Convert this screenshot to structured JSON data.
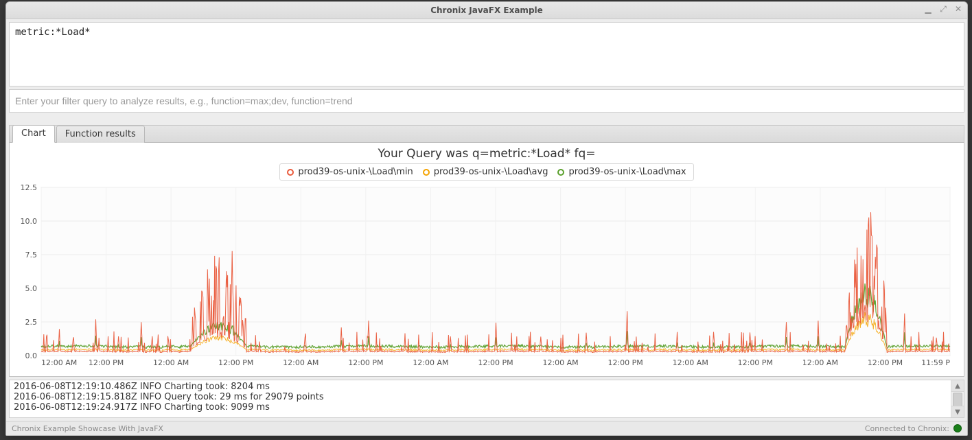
{
  "window": {
    "title": "Chronix JavaFX Example"
  },
  "query": {
    "value": "metric:*Load*"
  },
  "filter": {
    "placeholder": "Enter your filter query to analyze results, e.g., function=max;dev, function=trend",
    "value": ""
  },
  "tabs": [
    {
      "label": "Chart",
      "active": true
    },
    {
      "label": "Function results",
      "active": false
    }
  ],
  "chart_data": {
    "type": "line",
    "title": "Your Query was q=metric:*Load* fq=",
    "xlabel": "",
    "ylabel": "",
    "ylim": [
      0,
      12.5
    ],
    "yticks": [
      0.0,
      2.5,
      5.0,
      7.5,
      10.0,
      12.5
    ],
    "xticks": [
      "12:00 AM",
      "12:00 PM",
      "12:00 AM",
      "12:00 PM",
      "12:00 AM",
      "12:00 PM",
      "12:00 AM",
      "12:00 PM",
      "12:00 AM",
      "12:00 PM",
      "12:00 AM",
      "12:00 PM",
      "12:00 AM",
      "12:00 PM",
      "11:59 P"
    ],
    "legend_position": "top",
    "series": [
      {
        "name": "prod39-os-unix-\\Load\\min",
        "color": "#e9593a"
      },
      {
        "name": "prod39-os-unix-\\Load\\avg",
        "color": "#f4a300"
      },
      {
        "name": "prod39-os-unix-\\Load\\max",
        "color": "#5aa02c"
      }
    ],
    "baseline_note": "min/avg/max overlap near ~0.3–0.8 across most of the range; spikes are driven by the 'min' (orange-red) series; the green max band swells in burst regions.",
    "approx_spikes": [
      {
        "x_frac": 0.02,
        "max": 1.8
      },
      {
        "x_frac": 0.035,
        "max": 1.2
      },
      {
        "x_frac": 0.06,
        "max": 2.5
      },
      {
        "x_frac": 0.085,
        "max": 1.4
      },
      {
        "x_frac": 0.11,
        "max": 2.5
      },
      {
        "x_frac": 0.14,
        "max": 1.2
      },
      {
        "x_frac": 0.21,
        "max": 7.8
      },
      {
        "x_frac": 0.24,
        "max": 1.0
      },
      {
        "x_frac": 0.29,
        "max": 1.4
      },
      {
        "x_frac": 0.33,
        "max": 2.0
      },
      {
        "x_frac": 0.36,
        "max": 2.8
      },
      {
        "x_frac": 0.4,
        "max": 1.1
      },
      {
        "x_frac": 0.45,
        "max": 1.6
      },
      {
        "x_frac": 0.5,
        "max": 2.3
      },
      {
        "x_frac": 0.55,
        "max": 1.5
      },
      {
        "x_frac": 0.6,
        "max": 1.7
      },
      {
        "x_frac": 0.645,
        "max": 3.2
      },
      {
        "x_frac": 0.7,
        "max": 1.6
      },
      {
        "x_frac": 0.74,
        "max": 1.9
      },
      {
        "x_frac": 0.78,
        "max": 2.0
      },
      {
        "x_frac": 0.82,
        "max": 2.7
      },
      {
        "x_frac": 0.855,
        "max": 2.5
      },
      {
        "x_frac": 0.95,
        "max": 2.9
      },
      {
        "x_frac": 0.985,
        "max": 1.4
      }
    ],
    "burst_regions": [
      {
        "x_frac_start": 0.165,
        "x_frac_end": 0.225,
        "orange_peak": 7.8,
        "green_peak": 2.5
      },
      {
        "x_frac_start": 0.885,
        "x_frac_end": 0.93,
        "orange_peak": 11.3,
        "green_peak": 5.4
      }
    ]
  },
  "log": {
    "lines": [
      "2016-06-08T12:19:10.486Z INFO Charting took: 8204 ms",
      "2016-06-08T12:19:15.818Z INFO Query took: 29 ms for 29079 points",
      "2016-06-08T12:19:24.917Z INFO Charting took: 9099 ms"
    ]
  },
  "status": {
    "left": "Chronix Example Showcase With JavaFX",
    "right": "Connected to Chronix:"
  }
}
